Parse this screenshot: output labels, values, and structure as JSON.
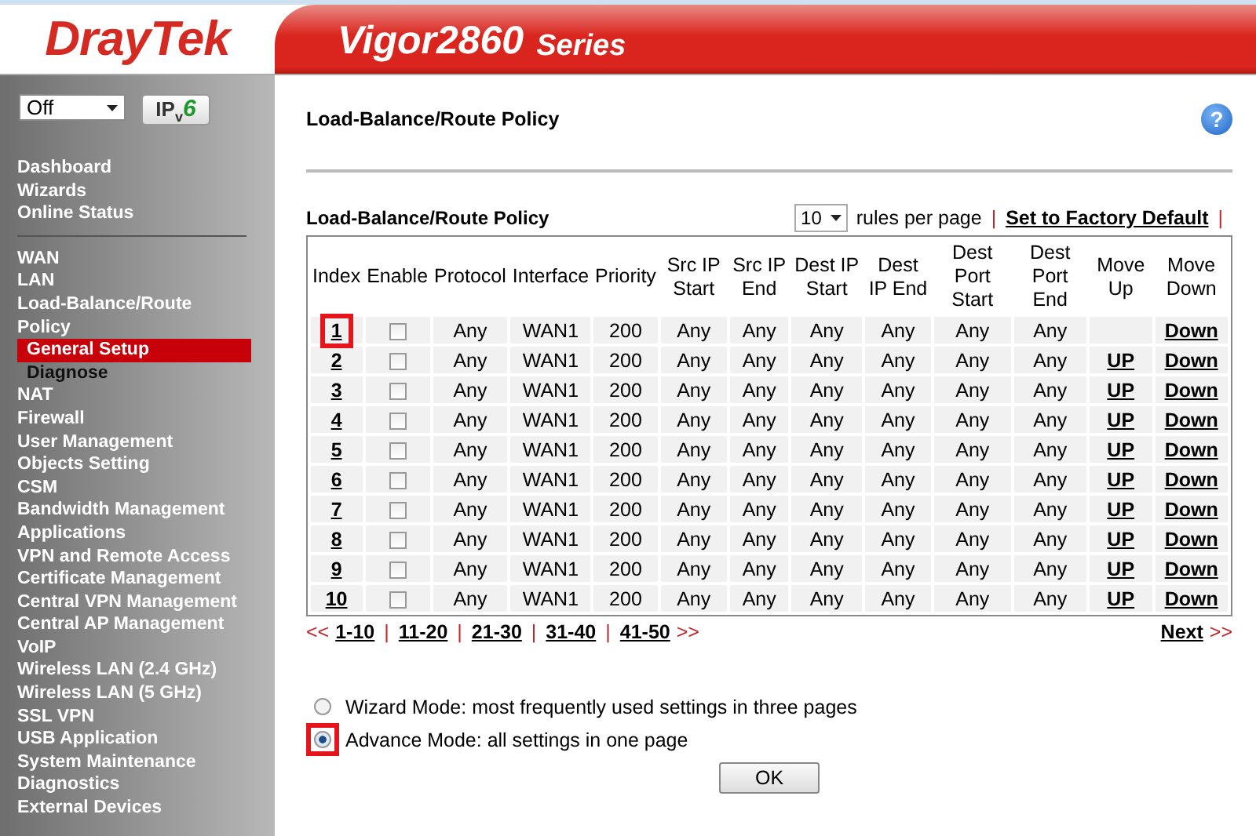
{
  "header": {
    "brand": "DrayTek",
    "model": "Vigor2860",
    "series": "Series"
  },
  "sidebar": {
    "mode_select": {
      "value": "Off"
    },
    "ipv6_button": {
      "prefix": "IP",
      "sub": "v",
      "accent": "6"
    },
    "items": [
      {
        "label": "Dashboard",
        "kind": "main",
        "selected": false
      },
      {
        "label": "Wizards",
        "kind": "main",
        "selected": false
      },
      {
        "label": "Online Status",
        "kind": "main",
        "selected": false
      },
      {
        "kind": "divider"
      },
      {
        "label": "WAN",
        "kind": "main",
        "selected": false
      },
      {
        "label": "LAN",
        "kind": "main",
        "selected": false
      },
      {
        "label": "Load-Balance/Route Policy",
        "kind": "main",
        "selected": false
      },
      {
        "label": "General Setup",
        "kind": "sub",
        "selected": true
      },
      {
        "label": "Diagnose",
        "kind": "sub",
        "selected": false
      },
      {
        "label": "NAT",
        "kind": "main",
        "selected": false
      },
      {
        "label": "Firewall",
        "kind": "main",
        "selected": false
      },
      {
        "label": "User Management",
        "kind": "main",
        "selected": false
      },
      {
        "label": "Objects Setting",
        "kind": "main",
        "selected": false
      },
      {
        "label": "CSM",
        "kind": "main",
        "selected": false
      },
      {
        "label": "Bandwidth Management",
        "kind": "main",
        "selected": false
      },
      {
        "label": "Applications",
        "kind": "main",
        "selected": false
      },
      {
        "label": "VPN and Remote Access",
        "kind": "main",
        "selected": false
      },
      {
        "label": "Certificate Management",
        "kind": "main",
        "selected": false
      },
      {
        "label": "Central VPN Management",
        "kind": "main",
        "selected": false
      },
      {
        "label": "Central AP Management",
        "kind": "main",
        "selected": false
      },
      {
        "label": "VoIP",
        "kind": "main",
        "selected": false
      },
      {
        "label": "Wireless LAN (2.4 GHz)",
        "kind": "main",
        "selected": false
      },
      {
        "label": "Wireless LAN (5 GHz)",
        "kind": "main",
        "selected": false
      },
      {
        "label": "SSL VPN",
        "kind": "main",
        "selected": false
      },
      {
        "label": "USB Application",
        "kind": "main",
        "selected": false
      },
      {
        "label": "System Maintenance",
        "kind": "main",
        "selected": false
      },
      {
        "label": "Diagnostics",
        "kind": "main",
        "selected": false
      },
      {
        "label": "External Devices",
        "kind": "main",
        "selected": false
      }
    ]
  },
  "page": {
    "title": "Load-Balance/Route Policy",
    "help": "?"
  },
  "separator": "|",
  "table": {
    "title": "Load-Balance/Route Policy",
    "per_page": {
      "value": "10",
      "label": "rules per page"
    },
    "factory_default": "Set to Factory Default",
    "columns": [
      "Index",
      "Enable",
      "Protocol",
      "Interface",
      "Priority",
      "Src IP Start",
      "Src IP End",
      "Dest IP Start",
      "Dest IP End",
      "Dest Port Start",
      "Dest Port End",
      "Move Up",
      "Move Down"
    ],
    "rows": [
      {
        "index": "1",
        "highlighted": true,
        "enabled": false,
        "protocol": "Any",
        "interface": "WAN1",
        "priority": "200",
        "src_ip_start": "Any",
        "src_ip_end": "Any",
        "dest_ip_start": "Any",
        "dest_ip_end": "Any",
        "dest_port_start": "Any",
        "dest_port_end": "Any",
        "move_down": "Down"
      },
      {
        "index": "2",
        "highlighted": false,
        "enabled": false,
        "protocol": "Any",
        "interface": "WAN1",
        "priority": "200",
        "src_ip_start": "Any",
        "src_ip_end": "Any",
        "dest_ip_start": "Any",
        "dest_ip_end": "Any",
        "dest_port_start": "Any",
        "dest_port_end": "Any",
        "move_up": "UP",
        "move_down": "Down"
      },
      {
        "index": "3",
        "highlighted": false,
        "enabled": false,
        "protocol": "Any",
        "interface": "WAN1",
        "priority": "200",
        "src_ip_start": "Any",
        "src_ip_end": "Any",
        "dest_ip_start": "Any",
        "dest_ip_end": "Any",
        "dest_port_start": "Any",
        "dest_port_end": "Any",
        "move_up": "UP",
        "move_down": "Down"
      },
      {
        "index": "4",
        "highlighted": false,
        "enabled": false,
        "protocol": "Any",
        "interface": "WAN1",
        "priority": "200",
        "src_ip_start": "Any",
        "src_ip_end": "Any",
        "dest_ip_start": "Any",
        "dest_ip_end": "Any",
        "dest_port_start": "Any",
        "dest_port_end": "Any",
        "move_up": "UP",
        "move_down": "Down"
      },
      {
        "index": "5",
        "highlighted": false,
        "enabled": false,
        "protocol": "Any",
        "interface": "WAN1",
        "priority": "200",
        "src_ip_start": "Any",
        "src_ip_end": "Any",
        "dest_ip_start": "Any",
        "dest_ip_end": "Any",
        "dest_port_start": "Any",
        "dest_port_end": "Any",
        "move_up": "UP",
        "move_down": "Down"
      },
      {
        "index": "6",
        "highlighted": false,
        "enabled": false,
        "protocol": "Any",
        "interface": "WAN1",
        "priority": "200",
        "src_ip_start": "Any",
        "src_ip_end": "Any",
        "dest_ip_start": "Any",
        "dest_ip_end": "Any",
        "dest_port_start": "Any",
        "dest_port_end": "Any",
        "move_up": "UP",
        "move_down": "Down"
      },
      {
        "index": "7",
        "highlighted": false,
        "enabled": false,
        "protocol": "Any",
        "interface": "WAN1",
        "priority": "200",
        "src_ip_start": "Any",
        "src_ip_end": "Any",
        "dest_ip_start": "Any",
        "dest_ip_end": "Any",
        "dest_port_start": "Any",
        "dest_port_end": "Any",
        "move_up": "UP",
        "move_down": "Down"
      },
      {
        "index": "8",
        "highlighted": false,
        "enabled": false,
        "protocol": "Any",
        "interface": "WAN1",
        "priority": "200",
        "src_ip_start": "Any",
        "src_ip_end": "Any",
        "dest_ip_start": "Any",
        "dest_ip_end": "Any",
        "dest_port_start": "Any",
        "dest_port_end": "Any",
        "move_up": "UP",
        "move_down": "Down"
      },
      {
        "index": "9",
        "highlighted": false,
        "enabled": false,
        "protocol": "Any",
        "interface": "WAN1",
        "priority": "200",
        "src_ip_start": "Any",
        "src_ip_end": "Any",
        "dest_ip_start": "Any",
        "dest_ip_end": "Any",
        "dest_port_start": "Any",
        "dest_port_end": "Any",
        "move_up": "UP",
        "move_down": "Down"
      },
      {
        "index": "10",
        "highlighted": false,
        "enabled": false,
        "protocol": "Any",
        "interface": "WAN1",
        "priority": "200",
        "src_ip_start": "Any",
        "src_ip_end": "Any",
        "dest_ip_start": "Any",
        "dest_ip_end": "Any",
        "dest_port_start": "Any",
        "dest_port_end": "Any",
        "move_up": "UP",
        "move_down": "Down"
      }
    ]
  },
  "pagination": {
    "prev": "<<",
    "pages": [
      "1-10",
      "11-20",
      "21-30",
      "31-40",
      "41-50"
    ],
    "next_arrows": ">>",
    "next": "Next",
    "next_trail": ">>"
  },
  "modes": [
    {
      "label": "Wizard Mode: most frequently used settings in three pages",
      "selected": false,
      "highlighted": false
    },
    {
      "label": "Advance Mode: all settings in one page",
      "selected": true,
      "highlighted": true
    }
  ],
  "ok_button": "OK"
}
